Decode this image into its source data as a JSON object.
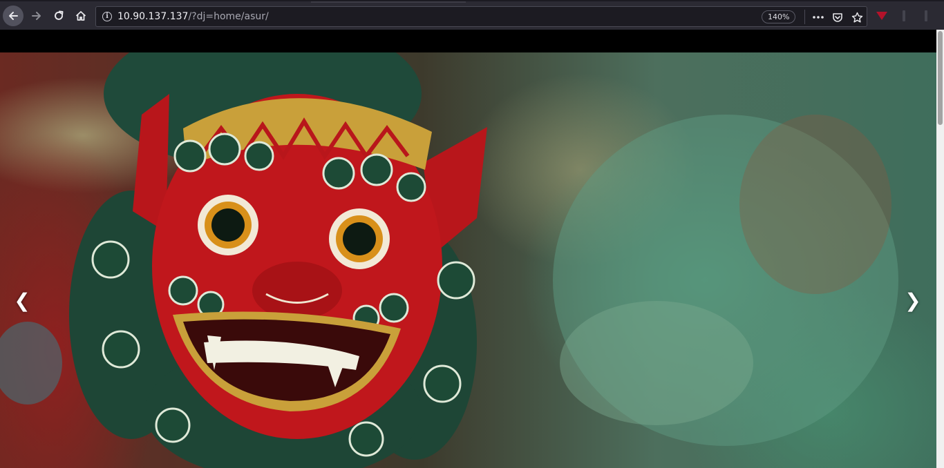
{
  "browser": {
    "url_host": "10.90.137.137",
    "url_path": "/?dj=home/asur/",
    "zoom": "140%",
    "icons": {
      "back": "back-arrow-icon",
      "forward": "forward-arrow-icon",
      "reload": "reload-icon",
      "home": "home-icon",
      "site_info": "info-icon",
      "more": "more-icon",
      "pocket": "pocket-icon",
      "bookmark": "star-icon"
    },
    "colors": {
      "toolbar": "#2b2a33",
      "urlbar": "#1c1b22",
      "extension_accent": "#b3122a"
    }
  },
  "page": {
    "carousel": {
      "prev_label": "❮",
      "next_label": "❯",
      "image": "red Balinese demon mask"
    },
    "scroll_position": 0.0
  }
}
